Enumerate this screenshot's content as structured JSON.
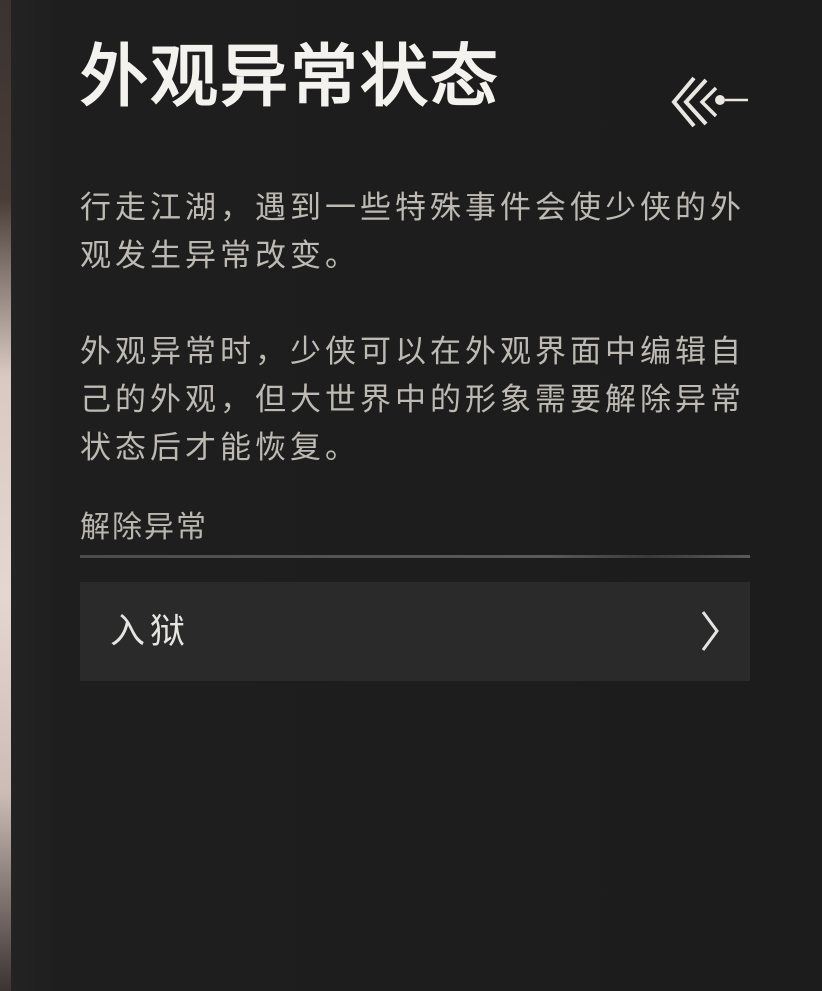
{
  "header": {
    "title": "外观异常状态",
    "back_icon": "back-arrow-icon"
  },
  "description": {
    "paragraph1": "行走江湖，遇到一些特殊事件会使少侠的外观发生异常改变。",
    "paragraph2": "外观异常时，少侠可以在外观界面中编辑自己的外观，但大世界中的形象需要解除异常状态后才能恢复。"
  },
  "section": {
    "label": "解除异常"
  },
  "items": [
    {
      "label": "入狱",
      "icon": "chevron-right-icon"
    }
  ],
  "colors": {
    "background": "#1c1c1c",
    "title_text": "#f4f2ee",
    "body_text": "#bdbab4",
    "item_background": "#2a2a2a"
  }
}
